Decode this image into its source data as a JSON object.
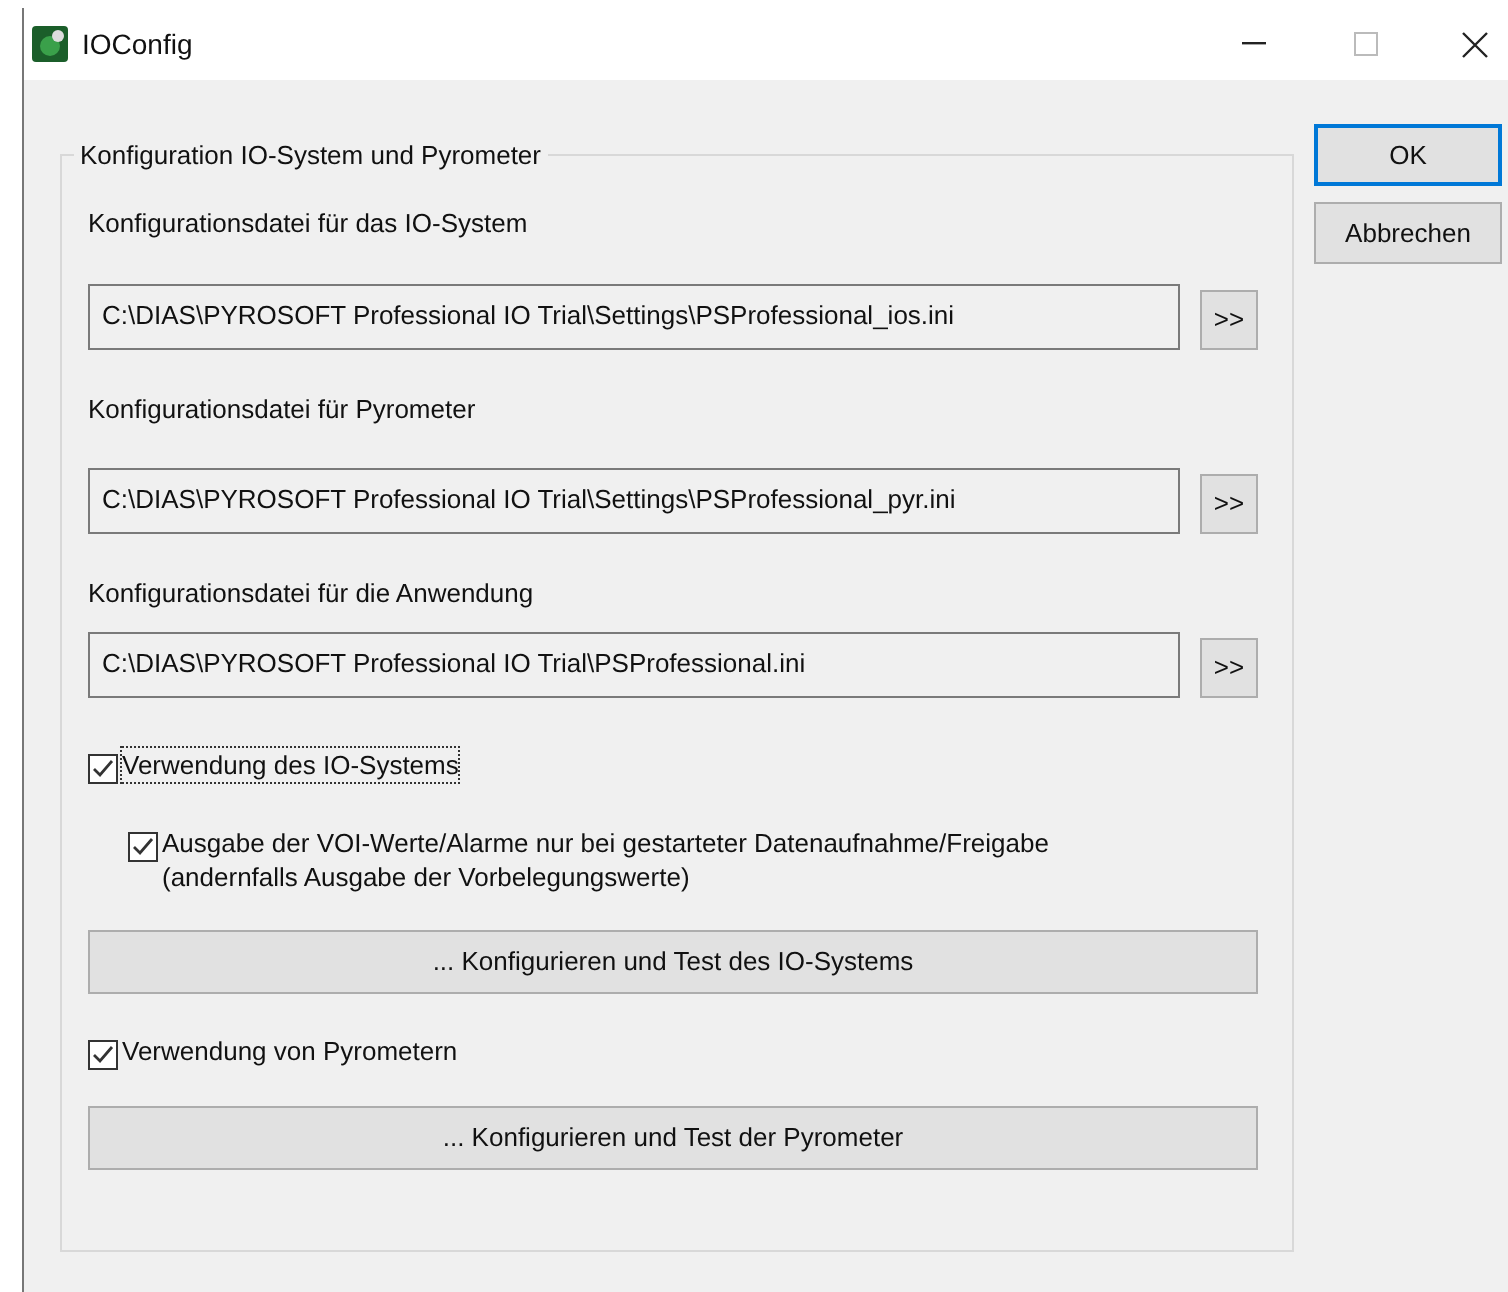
{
  "window": {
    "title": "IOConfig"
  },
  "group": {
    "legend": "Konfiguration IO-System und Pyrometer"
  },
  "files": [
    {
      "label": "Konfigurationsdatei für das IO-System",
      "path": "C:\\DIAS\\PYROSOFT Professional IO Trial\\Settings\\PSProfessional_ios.ini",
      "browse": ">>"
    },
    {
      "label": "Konfigurationsdatei für Pyrometer",
      "path": "C:\\DIAS\\PYROSOFT Professional IO Trial\\Settings\\PSProfessional_pyr.ini",
      "browse": ">>"
    },
    {
      "label": "Konfigurationsdatei für die Anwendung",
      "path": "C:\\DIAS\\PYROSOFT Professional IO Trial\\PSProfessional.ini",
      "browse": ">>"
    }
  ],
  "options": [
    {
      "kind": "checkbox",
      "lines": [
        "Verwendung des IO-Systems"
      ],
      "checked": true,
      "focused": true,
      "children": [
        {
          "lines": [
            "Ausgabe der VOI-Werte/Alarme nur bei gestarteter Datenaufnahme/Freigabe",
            "(andernfalls Ausgabe der Vorbelegungswerte)"
          ],
          "checked": true,
          "focused": false
        }
      ]
    },
    {
      "kind": "button",
      "label": "... Konfigurieren und Test des IO-Systems"
    },
    {
      "kind": "checkbox",
      "lines": [
        "Verwendung von Pyrometern"
      ],
      "checked": true,
      "focused": false
    },
    {
      "kind": "button",
      "label": "... Konfigurieren und Test der Pyrometer"
    }
  ],
  "buttons": [
    {
      "label": "OK",
      "default": true
    },
    {
      "label": "Abbrechen",
      "default": false
    }
  ]
}
